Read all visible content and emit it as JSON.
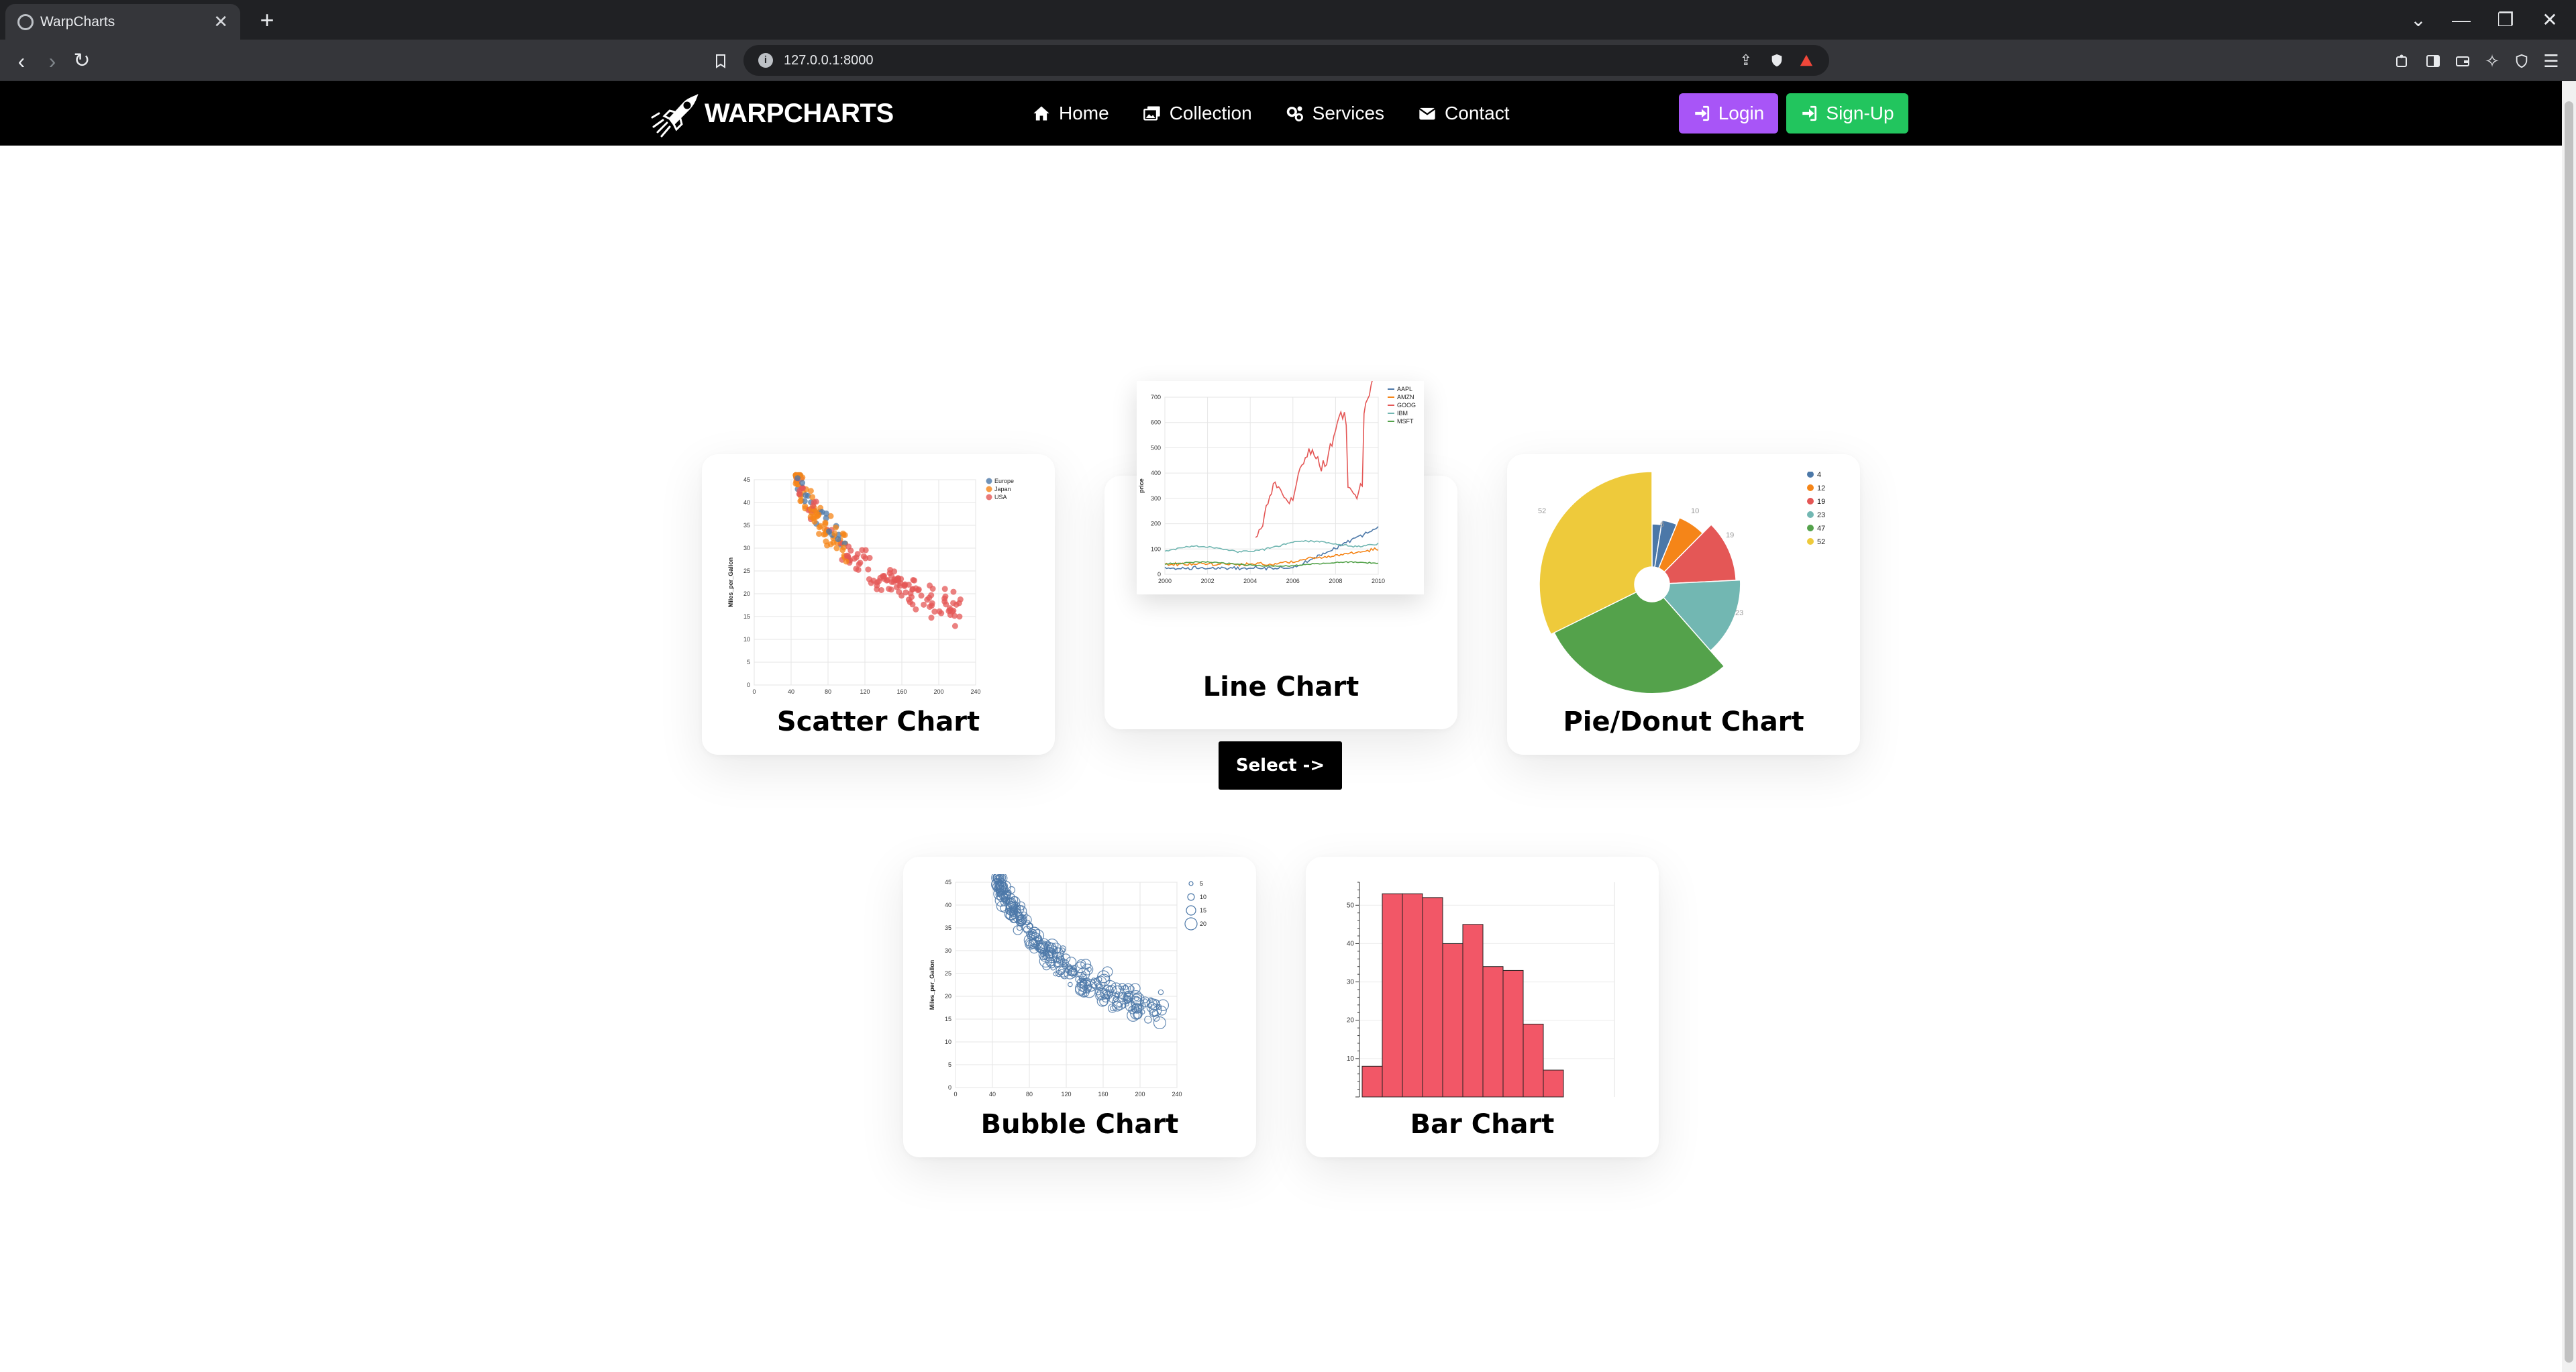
{
  "browser": {
    "tab_title": "WarpCharts",
    "tab_close": "✕",
    "new_tab": "+",
    "url": "127.0.0.1:8000",
    "window_controls": [
      "⌄",
      "—",
      "❐",
      "✕"
    ]
  },
  "site": {
    "brand": "WARPCHARTS",
    "nav": [
      {
        "label": "Home",
        "icon": "home-icon"
      },
      {
        "label": "Collection",
        "icon": "images-icon"
      },
      {
        "label": "Services",
        "icon": "gears-icon"
      },
      {
        "label": "Contact",
        "icon": "envelope-icon"
      }
    ],
    "login": {
      "label": "Login",
      "color": "#a855f7"
    },
    "signup": {
      "label": "Sign-Up",
      "color": "#22c55e"
    }
  },
  "cards": [
    {
      "title": "Scatter Chart"
    },
    {
      "title": "Line Chart",
      "button": "Select ->"
    },
    {
      "title": "Pie/Donut Chart"
    },
    {
      "title": "Bubble Chart"
    },
    {
      "title": "Bar Chart"
    }
  ],
  "thumbnails": {
    "scatter": {
      "ylabel": "Miles_per_Gallon",
      "yticks": [
        "45",
        "40",
        "35",
        "30",
        "25",
        "20",
        "15",
        "10",
        "5",
        "0"
      ],
      "xticks": [
        "0",
        "40",
        "80",
        "120",
        "160",
        "200",
        "240"
      ],
      "legend": [
        {
          "label": "Europe",
          "color": "#4c78a8"
        },
        {
          "label": "Japan",
          "color": "#f58518"
        },
        {
          "label": "USA",
          "color": "#e45756"
        }
      ]
    },
    "line": {
      "ylabel": "price",
      "yticks": [
        "700",
        "600",
        "500",
        "400",
        "300",
        "200",
        "100",
        "0"
      ],
      "xticks": [
        "2000",
        "2002",
        "2004",
        "2006",
        "2008",
        "2010"
      ],
      "legend": [
        {
          "label": "AAPL",
          "color": "#4c78a8"
        },
        {
          "label": "AMZN",
          "color": "#f58518"
        },
        {
          "label": "GOOG",
          "color": "#e45756"
        },
        {
          "label": "IBM",
          "color": "#72b7b2"
        },
        {
          "label": "MSFT",
          "color": "#54a24b"
        }
      ]
    },
    "pie": {
      "slices": [
        {
          "value": 4,
          "color": "#4c78a8"
        },
        {
          "value": 6,
          "color": "#4c78a8"
        },
        {
          "value": 10,
          "color": "#f58518"
        },
        {
          "value": 19,
          "color": "#e45756"
        },
        {
          "value": 23,
          "color": "#72b7b2"
        },
        {
          "value": 47,
          "color": "#54a24b"
        },
        {
          "value": 52,
          "color": "#eeca3b"
        }
      ],
      "slice_labels": [
        "6",
        "10",
        "19",
        "23",
        "52"
      ],
      "legend": [
        {
          "label": "4",
          "color": "#4c78a8"
        },
        {
          "label": "12",
          "color": "#f58518"
        },
        {
          "label": "19",
          "color": "#e45756"
        },
        {
          "label": "23",
          "color": "#72b7b2"
        },
        {
          "label": "47",
          "color": "#54a24b"
        },
        {
          "label": "52",
          "color": "#eeca3b"
        }
      ]
    },
    "bubble": {
      "ylabel": "Miles_per_Gallon",
      "yticks": [
        "45",
        "40",
        "35",
        "30",
        "25",
        "20",
        "15",
        "10",
        "5",
        "0"
      ],
      "xticks": [
        "0",
        "40",
        "80",
        "120",
        "160",
        "200",
        "240"
      ],
      "legend": [
        "5",
        "10",
        "15",
        "20"
      ]
    },
    "bar": {
      "yticks": [
        "50",
        "40",
        "30",
        "20",
        "10"
      ],
      "values": [
        8,
        53,
        53,
        52,
        40,
        45,
        34,
        33,
        19,
        7
      ],
      "ymax": 56,
      "color": "#f25767"
    }
  }
}
